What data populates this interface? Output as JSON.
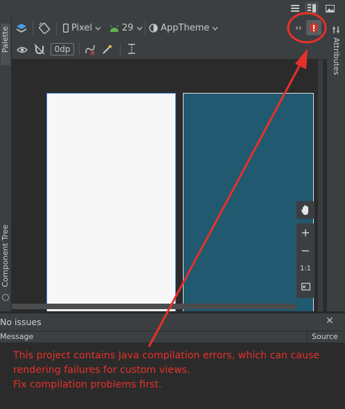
{
  "view_modes": {
    "icons": [
      "code-view-icon",
      "split-view-icon",
      "design-view-icon"
    ]
  },
  "side_tabs": {
    "palette": "Palette",
    "component_tree": "Component Tree",
    "attributes": "Attributes"
  },
  "toolbar": {
    "device": "Pixel",
    "api_level": "29",
    "theme": "AppTheme",
    "overflow": "››",
    "margin_value": "0dp"
  },
  "zoom": {
    "zoom_in": "+",
    "zoom_out": "−",
    "actual_size": "1:1"
  },
  "issues": {
    "status": "No issues",
    "close": "✕",
    "col_message": "Message",
    "col_source": "Source"
  },
  "annotation": {
    "text": "This project contains Java compilation errors, which can cause rendering failures for custom views.\nFix compilation problems first.",
    "color": "#e8302a"
  },
  "colors": {
    "panel_bg": "#3c3f41",
    "canvas_bg": "#2b2b2b",
    "design_surface": "#215970",
    "blueprint_surface": "#f7f7f7",
    "error_badge": "#c8372d"
  }
}
